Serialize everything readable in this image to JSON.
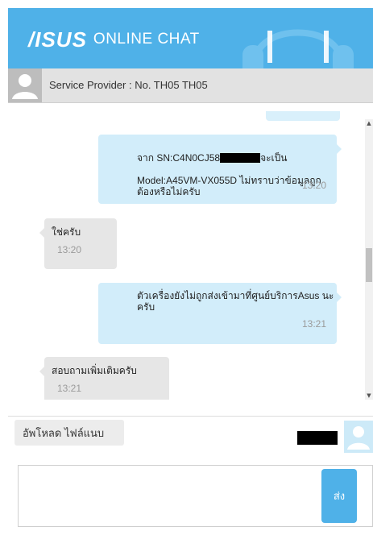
{
  "header": {
    "logo_mark": "/ISUS",
    "title": "ONLINE CHAT",
    "bg_color": "#4fb1e8"
  },
  "provider": {
    "label": "Service Provider : No. TH05 TH05",
    "avatar_icon": "user-silhouette-icon"
  },
  "messages": [
    {
      "direction": "out",
      "text_prefix": "จาก SN:C4N0CJ58",
      "text_suffix": "จะเป็น",
      "text_rest": "Model:A45VM-VX055D ไม่ทราบว่าข้อมูลถูก\nต้องหรือไม่ครับ",
      "time": "13:20"
    },
    {
      "direction": "in",
      "text": "ใช่ครับ",
      "time": "13:20"
    },
    {
      "direction": "out",
      "text": "ตัวเครื่องยังไม่ถูกส่งเข้ามาที่ศูนย์บริการAsus นะ\nครับ",
      "time": "13:21"
    },
    {
      "direction": "in",
      "text": "สอบถามเพิ่มเติมครับ",
      "time": "13:21"
    }
  ],
  "upload": {
    "label": "อัพโหลด ไฟล์แนบ"
  },
  "compose": {
    "value": "",
    "send_label": "ส่ง"
  },
  "colors": {
    "accent": "#4fb1e8",
    "outgoing_bubble": "#d2edfa",
    "incoming_bubble": "#e6e6e6"
  }
}
